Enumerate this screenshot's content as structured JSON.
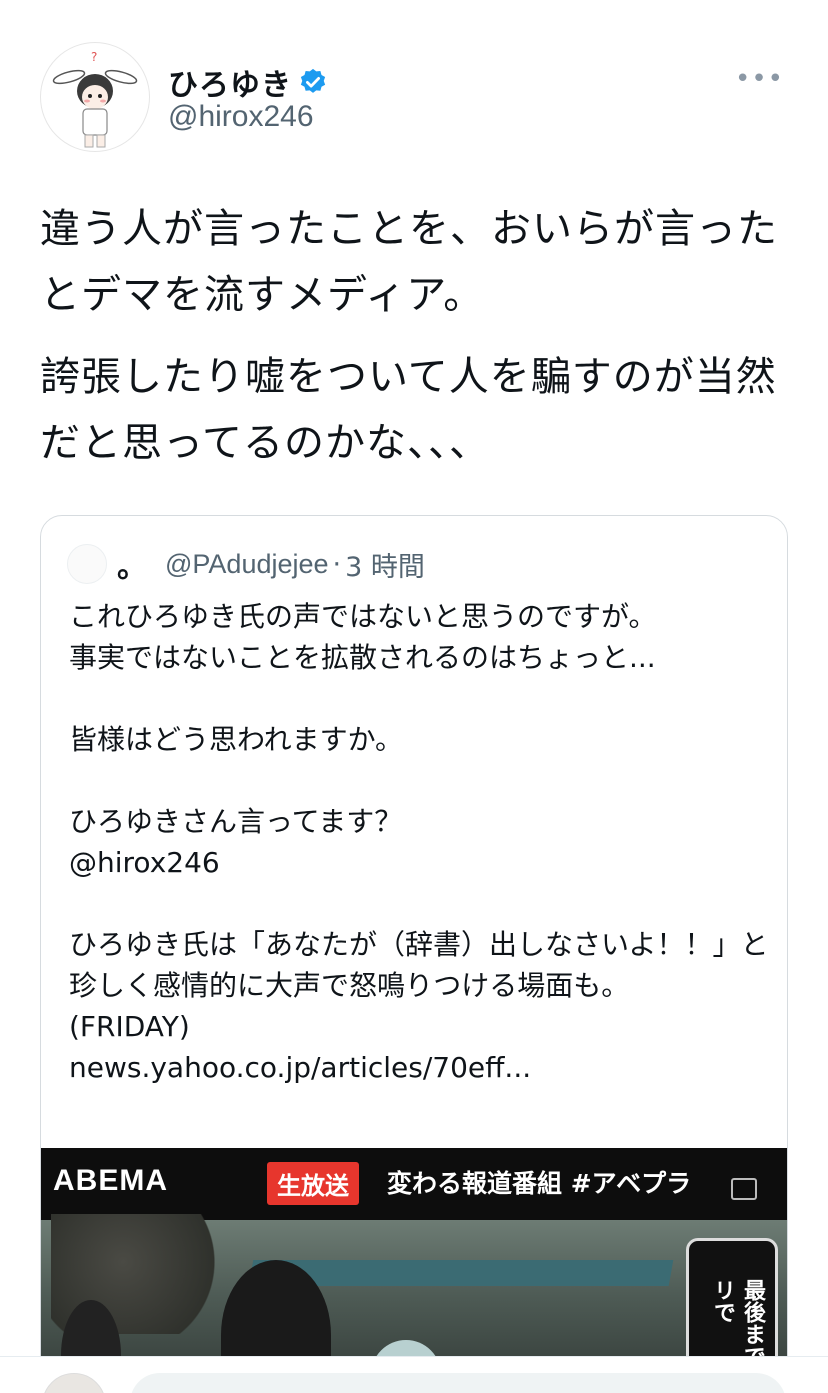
{
  "tweet": {
    "author_name": "ひろゆき",
    "author_handle": "@hirox246",
    "verified": true,
    "more_label": "•••",
    "body": [
      "違う人が言ったことを、おいらが言ったとデマを流すメディア。",
      "誇張したり嘘をついて人を騙すのが当然だと思ってるのかな、、、"
    ]
  },
  "quoted": {
    "name": "。",
    "handle": "@PAdudjejee",
    "separator": "·",
    "time": "3 時間",
    "text": "これひろゆき氏の声ではないと思うのですが。\n事実ではないことを拡散されるのはちょっと...\n\n皆様はどう思われますか。\n\nひろゆきさん言ってます？\n@hirox246\n\nひろゆき氏は「あなたが（辞書）出しなさいよ！！」と珍しく感情的に大声で怒鳴りつける場面も。\n(FRIDAY)\nnews.yahoo.co.jp/articles/70eff...",
    "media": {
      "logo": "ABEMA",
      "live_badge": "生放送",
      "title": "変わる報道番組 #アベプラ",
      "side_text": "最後まで アプリで"
    }
  },
  "colors": {
    "verified_blue": "#1d9bf0",
    "live_red": "#e7362d",
    "muted_gray": "#536471"
  }
}
